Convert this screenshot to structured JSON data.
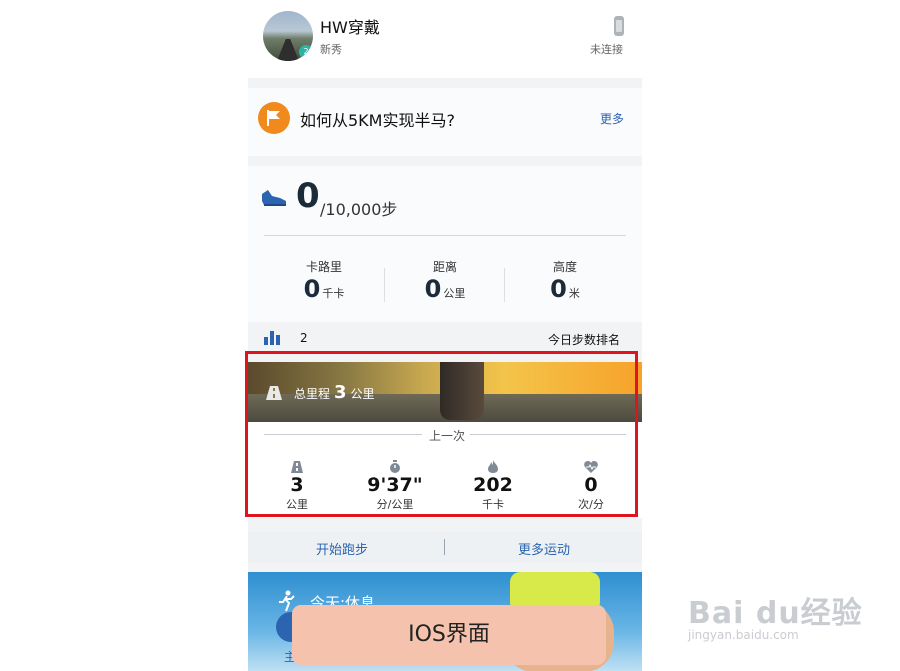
{
  "profile": {
    "name": "HW穿戴",
    "level": "新秀",
    "badge": "2",
    "connection_status": "未连接"
  },
  "tip": {
    "text": "如何从5KM实现半马?",
    "more": "更多"
  },
  "steps": {
    "value": "0",
    "goal": "/10,000步",
    "stats": [
      {
        "label": "卡路里",
        "value": "0",
        "unit": "千卡"
      },
      {
        "label": "距离",
        "value": "0",
        "unit": "公里"
      },
      {
        "label": "高度",
        "value": "0",
        "unit": "米"
      }
    ]
  },
  "rank": {
    "value": "2",
    "label": "今日步数排名"
  },
  "running": {
    "total_label": "总里程",
    "total_value": "3",
    "total_unit": "公里",
    "last_label": "上一次",
    "stats": [
      {
        "icon": "road-icon",
        "value": "3",
        "unit": "公里"
      },
      {
        "icon": "stopwatch-icon",
        "value": "9'37\"",
        "unit": "分/公里"
      },
      {
        "icon": "flame-icon",
        "value": "202",
        "unit": "千卡"
      },
      {
        "icon": "heart-rate-icon",
        "value": "0",
        "unit": "次/分"
      }
    ]
  },
  "actions": {
    "start_run": "开始跑步",
    "more_sports": "更多运动"
  },
  "today": {
    "label": "今天:休息"
  },
  "tabbar": {
    "home_label": "主"
  },
  "overlay": {
    "label": "IOS界面"
  },
  "watermark": {
    "brand": "Bai du经验",
    "url": "jingyan.baidu.com"
  },
  "colors": {
    "accent": "#2b64b0",
    "highlight": "#e0141e",
    "tip_orange": "#f08a1c",
    "overlay_bg": "#f5c3ad"
  }
}
